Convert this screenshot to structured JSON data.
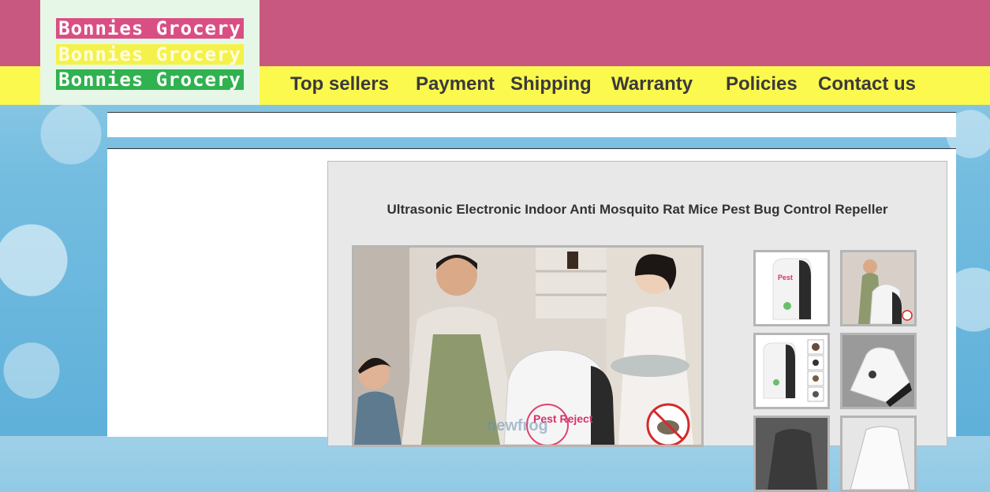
{
  "brand": {
    "logo_lines": [
      "Bonnies Grocery",
      "Bonnies Grocery",
      "Bonnies Grocery"
    ]
  },
  "nav": [
    {
      "label": "Top sellers"
    },
    {
      "label": "Payment"
    },
    {
      "label": "Shipping"
    },
    {
      "label": "Warranty"
    },
    {
      "label": "Policies"
    },
    {
      "label": "Contact us"
    }
  ],
  "product": {
    "title": "Ultrasonic Electronic Indoor Anti Mosquito Rat Mice Pest Bug Control Repeller",
    "device_label": "Pest Reject",
    "watermark": "newfrog"
  },
  "colors": {
    "header_pink": "#c95880",
    "nav_yellow": "#fbf84e",
    "logo_green": "#2fb24f"
  }
}
